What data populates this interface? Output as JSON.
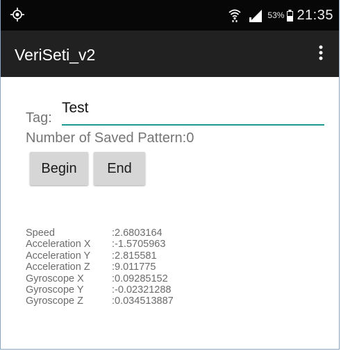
{
  "status_bar": {
    "battery_percent": "53%",
    "time": "21:35",
    "icons": [
      "location-icon",
      "wifi-icon",
      "signal-icon",
      "battery-icon"
    ]
  },
  "app_bar": {
    "title": "VeriSeti_v2",
    "menu_icon": "overflow-menu-icon"
  },
  "form": {
    "tag_label": "Tag:",
    "tag_value": "Test",
    "saved_pattern_text": "Number of Saved Pattern:0",
    "begin_label": "Begin",
    "end_label": "End"
  },
  "readings": [
    {
      "label": "Speed",
      "value": ":2.6803164"
    },
    {
      "label": "Acceleration X",
      "value": ":-1.5705963"
    },
    {
      "label": "Acceleration Y",
      "value": ":2.815581"
    },
    {
      "label": "Acceleration Z",
      "value": ":9.011775"
    },
    {
      "label": "Gyroscope X",
      "value": ":0.09285152"
    },
    {
      "label": "Gyroscope Y",
      "value": ":-0.02321288"
    },
    {
      "label": "Gyroscope Z",
      "value": ":0.034513887"
    }
  ],
  "colors": {
    "status_bar": "#070707",
    "app_bar": "#212121",
    "accent": "#1c9a8f",
    "button": "#d6d6d6"
  }
}
